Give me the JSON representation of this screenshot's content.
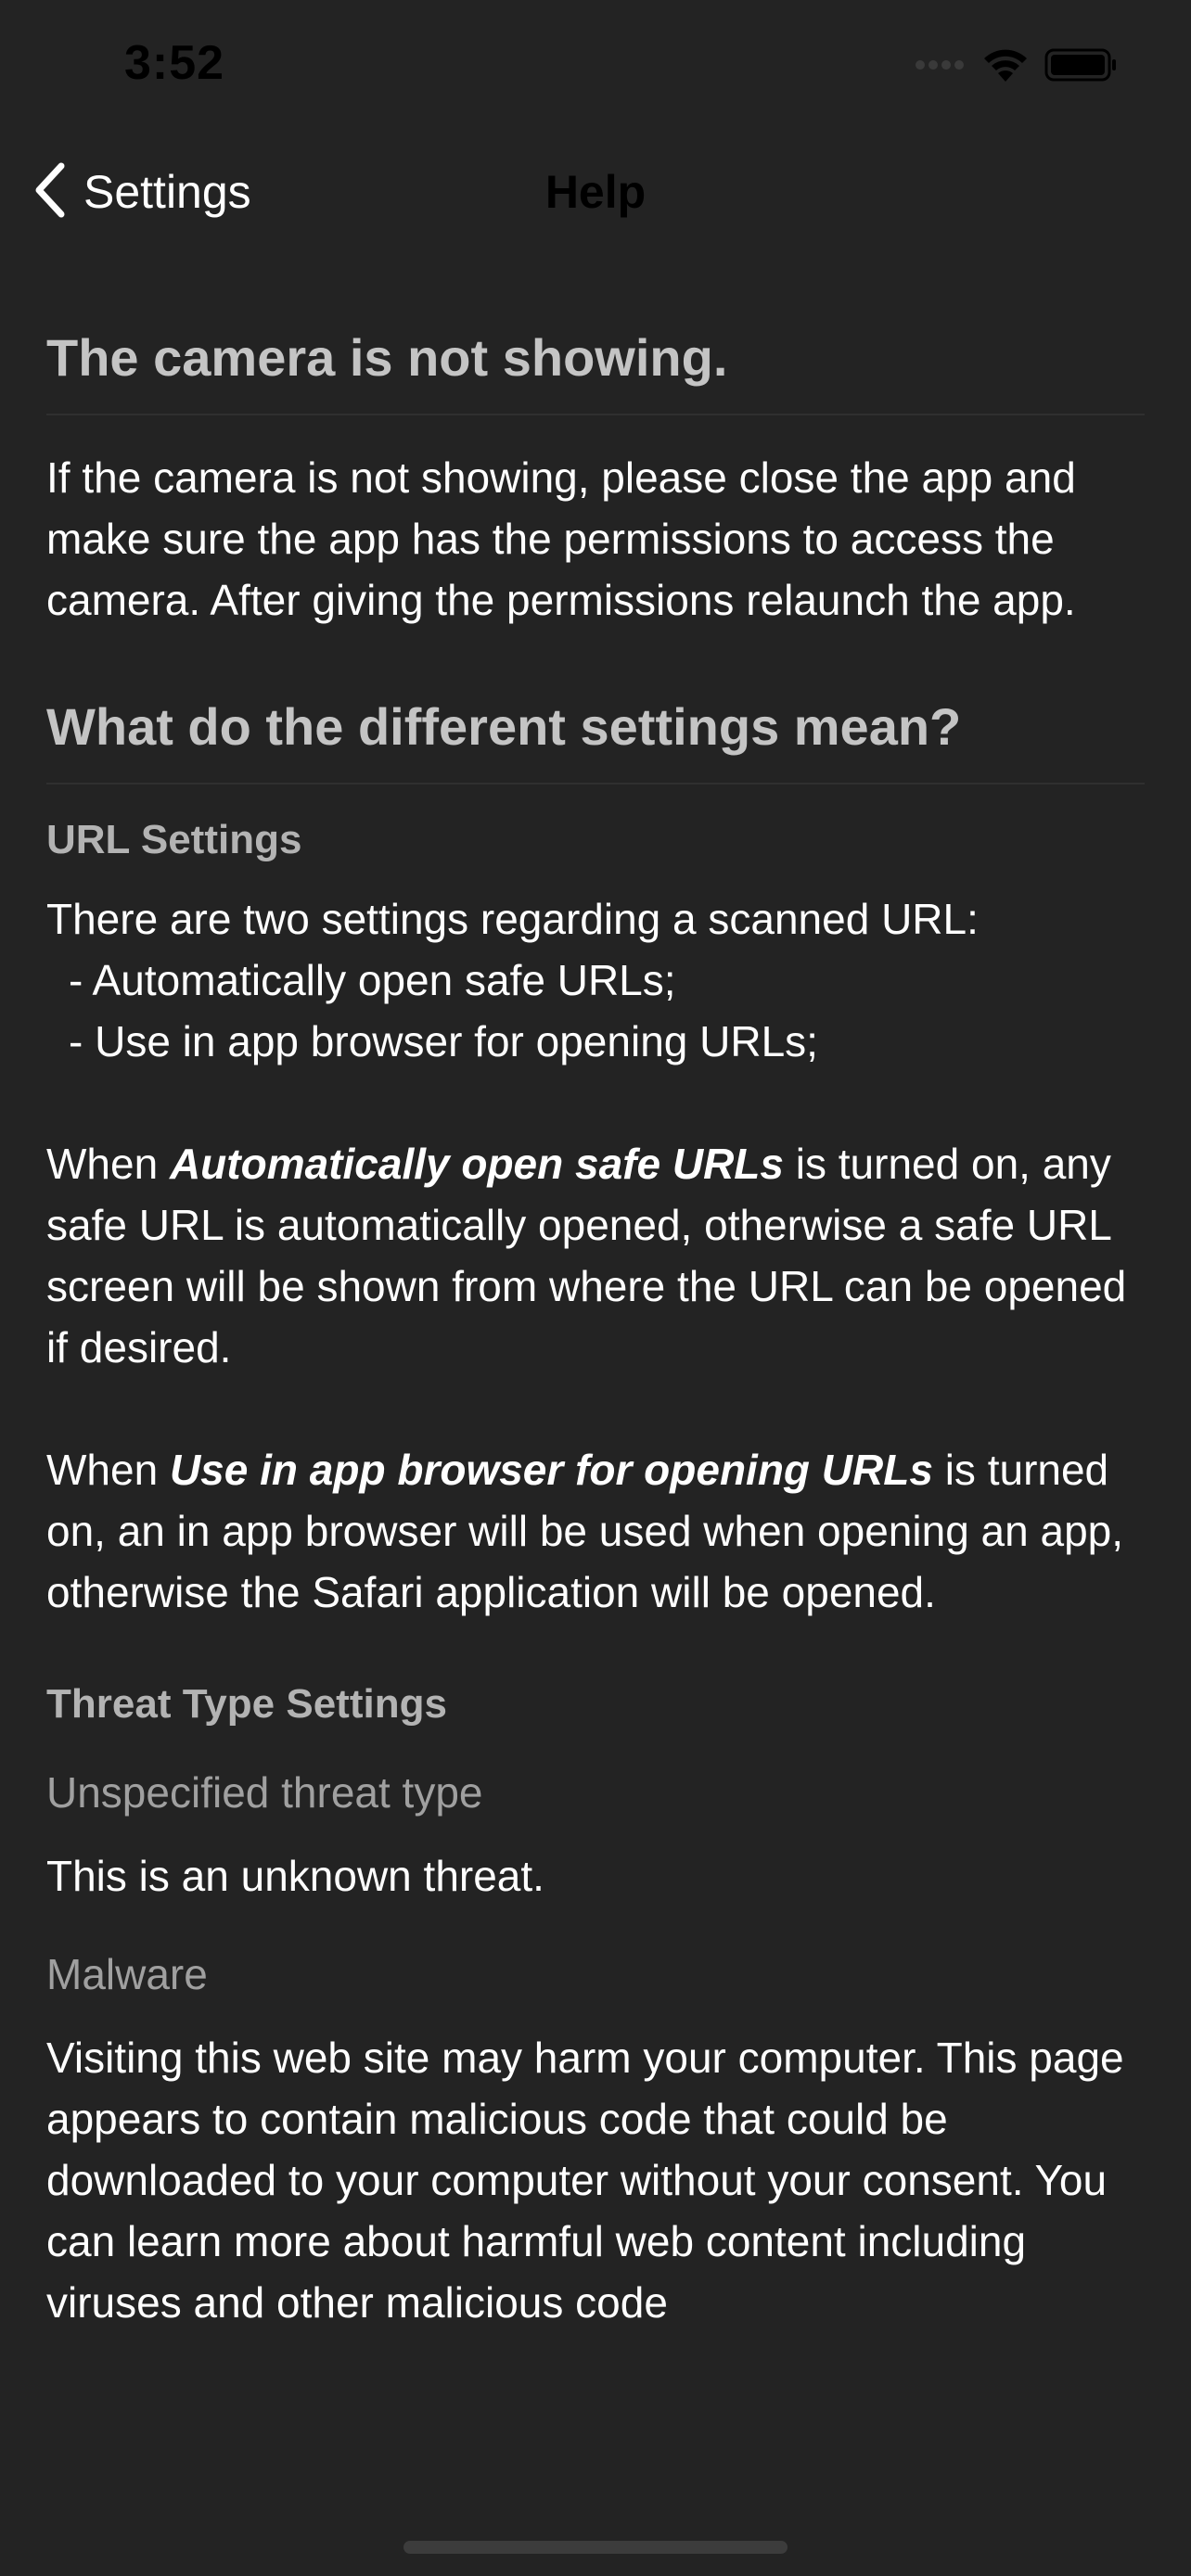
{
  "status_bar": {
    "time": "3:52",
    "icons": [
      "signal-icon",
      "wifi-icon",
      "battery-icon"
    ]
  },
  "nav": {
    "back_label": "Settings",
    "title": "Help"
  },
  "camera_section": {
    "heading": "The camera is not showing.",
    "body": "If the camera is not showing, please close the app and make sure the app has the permissions to access the camera. After giving the permissions relaunch the app."
  },
  "settings_section": {
    "heading": "What do the different settings mean?",
    "url_settings": {
      "title": "URL Settings",
      "intro": "There are two settings regarding a scanned URL:",
      "options": [
        "- Automatically open safe URLs;",
        "- Use in app browser for opening URLs;"
      ],
      "auto_open": {
        "prefix": "When ",
        "emphasis": "Automatically open safe URLs",
        "suffix": " is turned on, any safe URL is automatically opened, otherwise a safe URL screen will be shown from where the URL can be opened if desired."
      },
      "in_app": {
        "prefix": "When ",
        "emphasis": "Use in app browser for opening URLs",
        "suffix": " is turned on, an in app browser will be used when opening an app, otherwise the Safari application will be opened."
      }
    },
    "threat_settings": {
      "title": "Threat Type Settings",
      "types": [
        {
          "name": "Unspecified threat type",
          "description": "This is an unknown threat."
        },
        {
          "name": "Malware",
          "description": "Visiting this web site may harm your computer. This page appears to contain malicious code that could be downloaded to your computer without your consent. You can learn more about harmful web content including viruses and other malicious code"
        }
      ]
    }
  },
  "colors": {
    "background": "#232323",
    "heading": "#c4c4c4",
    "subheading": "#b3b3b3",
    "threat_name": "#a0a0a0",
    "text": "#ffffff"
  }
}
